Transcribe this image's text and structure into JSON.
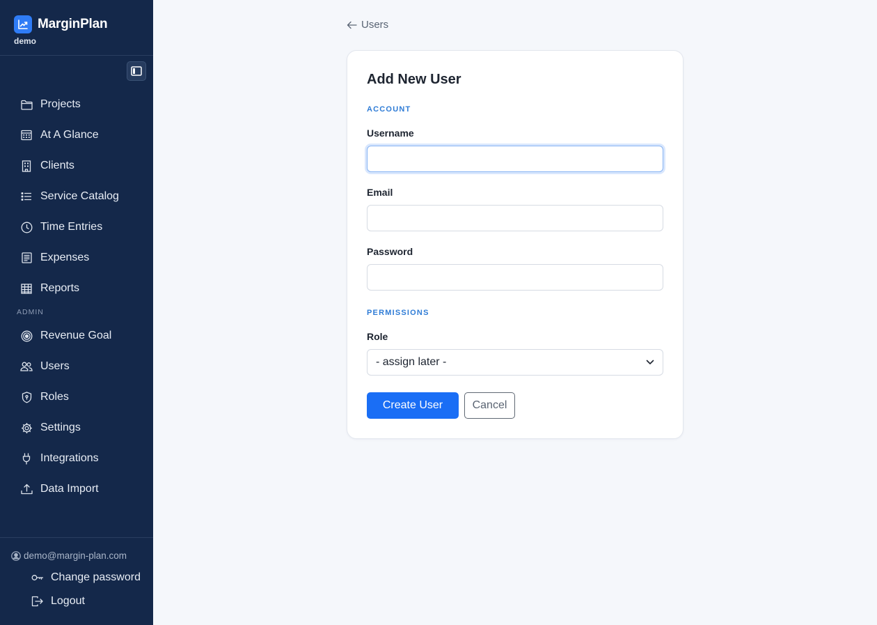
{
  "brand": {
    "name": "MarginPlan",
    "workspace": "demo",
    "logo_icon": "chart-up-icon",
    "accent": "#2f7cf6"
  },
  "sidebar": {
    "toggle_icon": "sidebar-toggle-icon",
    "items": [
      {
        "label": "Projects",
        "icon": "folder-icon"
      },
      {
        "label": "At A Glance",
        "icon": "calendar-grid-icon"
      },
      {
        "label": "Clients",
        "icon": "building-icon"
      },
      {
        "label": "Service Catalog",
        "icon": "list-icon"
      },
      {
        "label": "Time Entries",
        "icon": "clock-icon"
      },
      {
        "label": "Expenses",
        "icon": "receipt-icon"
      },
      {
        "label": "Reports",
        "icon": "table-icon"
      }
    ],
    "admin_section_label": "ADMIN",
    "admin_items": [
      {
        "label": "Revenue Goal",
        "icon": "target-icon"
      },
      {
        "label": "Users",
        "icon": "users-icon"
      },
      {
        "label": "Roles",
        "icon": "shield-icon"
      },
      {
        "label": "Settings",
        "icon": "gear-icon"
      },
      {
        "label": "Integrations",
        "icon": "plug-icon"
      },
      {
        "label": "Data Import",
        "icon": "upload-icon"
      }
    ],
    "account": {
      "email": "demo@margin-plan.com",
      "change_password": "Change password",
      "logout": "Logout"
    }
  },
  "main": {
    "back_label": "Users",
    "form": {
      "title": "Add New User",
      "account_section": "ACCOUNT",
      "username_label": "Username",
      "username_value": "",
      "email_label": "Email",
      "email_value": "",
      "password_label": "Password",
      "password_value": "",
      "permissions_section": "PERMISSIONS",
      "role_label": "Role",
      "role_selected": "- assign later -",
      "submit_label": "Create User",
      "cancel_label": "Cancel"
    }
  },
  "colors": {
    "sidebar_bg": "#14284a",
    "primary": "#1a6ef5",
    "section_label": "#2f7cd6",
    "page_bg": "#f5f7fb"
  }
}
